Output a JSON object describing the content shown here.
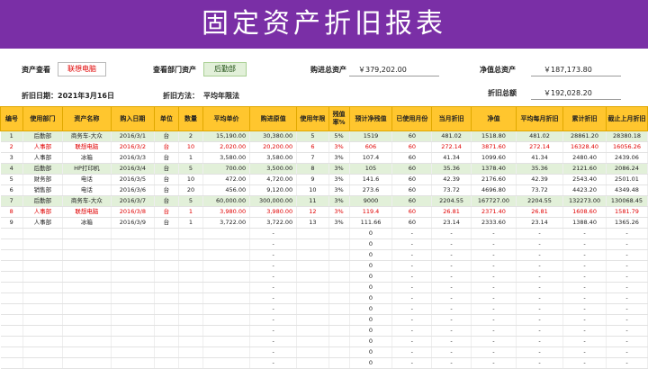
{
  "title": "固定资产折旧报表",
  "header": {
    "asset_view_label": "资产查看",
    "asset_view_value": "联想电脑",
    "dept_view_label": "查看部门资产",
    "dept_view_value": "后勤部",
    "purchase_total_label": "购进总资产",
    "purchase_total_value": "￥379,202.00",
    "net_total_label": "净值总资产",
    "net_total_value": "￥187,173.80",
    "dep_date_label": "折旧日期：",
    "dep_date_value": "2021年3月16日",
    "dep_method_label": "折旧方法：",
    "dep_method_value": "平均年限法",
    "dep_total_label": "折旧总额",
    "dep_total_value": "￥192,028.20"
  },
  "table": {
    "columns": [
      "编号",
      "使用部门",
      "资产名称",
      "购入日期",
      "单位",
      "数量",
      "平均单价",
      "购进原值",
      "使用年限",
      "残值率%",
      "预计净残值",
      "已使用月份",
      "当月折旧",
      "净值",
      "平均每月折旧",
      "累计折旧",
      "截止上月折旧"
    ],
    "rows": [
      {
        "style": "green",
        "cells": [
          "1",
          "后勤部",
          "商务车-大众",
          "2016/3/1",
          "台",
          "2",
          "15,190.00",
          "30,380.00",
          "5",
          "5%",
          "1519",
          "60",
          "481.02",
          "1518.80",
          "481.02",
          "28861.20",
          "28380.18"
        ]
      },
      {
        "style": "red",
        "cells": [
          "2",
          "人事部",
          "联想电脑",
          "2016/3/2",
          "台",
          "10",
          "2,020.00",
          "20,200.00",
          "6",
          "3%",
          "606",
          "60",
          "272.14",
          "3871.60",
          "272.14",
          "16328.40",
          "16056.26"
        ]
      },
      {
        "style": "",
        "cells": [
          "3",
          "人事部",
          "冰箱",
          "2016/3/3",
          "台",
          "1",
          "3,580.00",
          "3,580.00",
          "7",
          "3%",
          "107.4",
          "60",
          "41.34",
          "1099.60",
          "41.34",
          "2480.40",
          "2439.06"
        ]
      },
      {
        "style": "green",
        "cells": [
          "4",
          "后勤部",
          "HP打印机",
          "2016/3/4",
          "台",
          "5",
          "700.00",
          "3,500.00",
          "8",
          "3%",
          "105",
          "60",
          "35.36",
          "1378.40",
          "35.36",
          "2121.60",
          "2086.24"
        ]
      },
      {
        "style": "",
        "cells": [
          "5",
          "财务部",
          "电话",
          "2016/3/5",
          "台",
          "10",
          "472.00",
          "4,720.00",
          "9",
          "3%",
          "141.6",
          "60",
          "42.39",
          "2176.60",
          "42.39",
          "2543.40",
          "2501.01"
        ]
      },
      {
        "style": "",
        "cells": [
          "6",
          "销售部",
          "电话",
          "2016/3/6",
          "台",
          "20",
          "456.00",
          "9,120.00",
          "10",
          "3%",
          "273.6",
          "60",
          "73.72",
          "4696.80",
          "73.72",
          "4423.20",
          "4349.48"
        ]
      },
      {
        "style": "green",
        "cells": [
          "7",
          "后勤部",
          "商务车-大众",
          "2016/3/7",
          "台",
          "5",
          "60,000.00",
          "300,000.00",
          "11",
          "3%",
          "9000",
          "60",
          "2204.55",
          "167727.00",
          "2204.55",
          "132273.00",
          "130068.45"
        ]
      },
      {
        "style": "red",
        "cells": [
          "8",
          "人事部",
          "联想电脑",
          "2016/3/8",
          "台",
          "1",
          "3,980.00",
          "3,980.00",
          "12",
          "3%",
          "119.4",
          "60",
          "26.81",
          "2371.40",
          "26.81",
          "1608.60",
          "1581.79"
        ]
      },
      {
        "style": "",
        "cells": [
          "9",
          "人事部",
          "冰箱",
          "2016/3/9",
          "台",
          "1",
          "3,722.00",
          "3,722.00",
          "13",
          "3%",
          "111.66",
          "60",
          "23.14",
          "2333.60",
          "23.14",
          "1388.40",
          "1365.26"
        ]
      }
    ],
    "empty_row": [
      "",
      "",
      "",
      "",
      "",
      "",
      "",
      "-",
      "",
      "",
      "0",
      "-",
      "-",
      "-",
      "-",
      "-",
      "-"
    ],
    "empty_row_count": 13
  }
}
